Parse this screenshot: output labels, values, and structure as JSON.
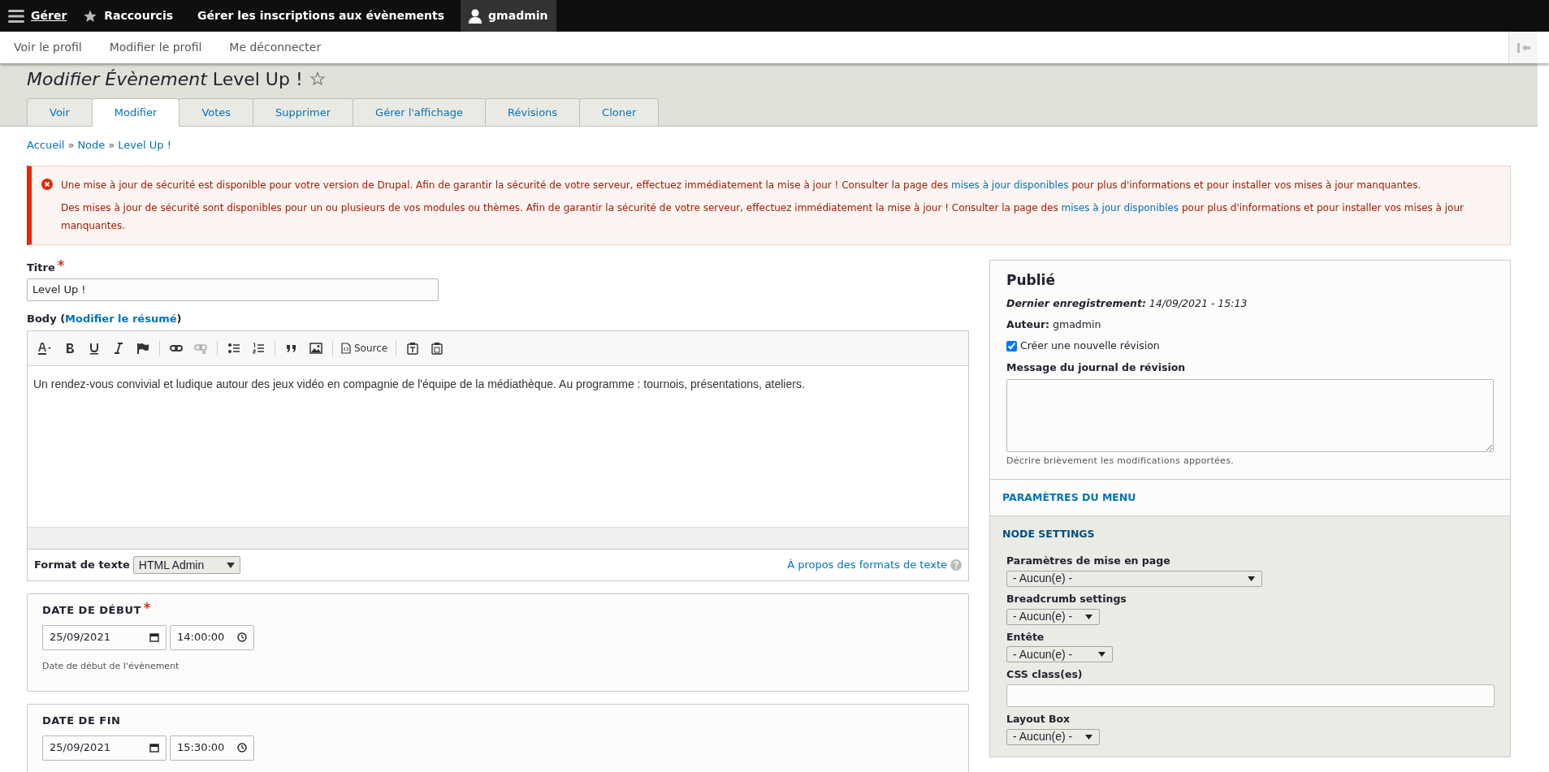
{
  "toolbar": {
    "items": [
      {
        "kind": "menu",
        "label": "Gérer",
        "selected": false
      },
      {
        "kind": "shortcuts",
        "label": "Raccourcis",
        "selected": false
      },
      {
        "kind": "link",
        "label": "Gérer les inscriptions aux évènements",
        "selected": false
      },
      {
        "kind": "user",
        "label": "gmadmin",
        "selected": true
      }
    ]
  },
  "tray": {
    "items": [
      "Voir le profil",
      "Modifier le profil",
      "Me déconnecter"
    ]
  },
  "page_title": {
    "prefix": "Modifier Évènement",
    "name": "Level Up !"
  },
  "tabs": [
    {
      "label": "Voir",
      "selected": false
    },
    {
      "label": "Modifier",
      "selected": true
    },
    {
      "label": "Votes",
      "selected": false
    },
    {
      "label": "Supprimer",
      "selected": false
    },
    {
      "label": "Gérer l'affichage",
      "selected": false
    },
    {
      "label": "Révisions",
      "selected": false
    },
    {
      "label": "Cloner",
      "selected": false
    }
  ],
  "breadcrumb": {
    "separator": "»",
    "items": [
      "Accueil",
      "Node",
      "Level Up !"
    ]
  },
  "alert": {
    "messages": [
      {
        "before": "Une mise à jour de sécurité est disponible pour votre version de Drupal. Afin de garantir la sécurité de votre serveur, effectuez immédiatement la mise à jour ! Consulter la page des",
        "link": "mises à jour disponibles",
        "after": "pour plus d'informations et pour installer vos mises à jour manquantes."
      },
      {
        "before": "Des mises à jour de sécurité sont disponibles pour un ou plusieurs de vos modules ou thèmes. Afin de garantir la sécurité de votre serveur, effectuez immédiatement la mise à jour ! Consulter la page des",
        "link": "mises à jour disponibles",
        "after": "pour plus d'informations et pour installer vos mises à jour manquantes."
      }
    ]
  },
  "title_field": {
    "label": "Titre",
    "required": true,
    "value": "Level Up !"
  },
  "body": {
    "label": "Body",
    "paren_open": "(",
    "paren_close": ")",
    "link": "Modifier le résumé",
    "source_label": "Source",
    "content": "Un rendez-vous convivial et ludique autour des jeux vidéo en compagnie de l'équipe de la médiathèque. Au programme : tournois, présentations, ateliers.",
    "format_label": "Format de texte",
    "format_value": "HTML Admin",
    "help_link": "À propos des formats de texte"
  },
  "dates": [
    {
      "label": "DATE DE DÉBUT",
      "required": true,
      "date": "25/09/2021",
      "time": "14:00:00",
      "description": "Date de début de l'évènement"
    },
    {
      "label": "DATE DE FIN",
      "required": false,
      "date": "25/09/2021",
      "time": "15:30:00"
    }
  ],
  "sidebar": {
    "status": "Publié",
    "last_saved_label": "Dernier enregistrement:",
    "last_saved": "14/09/2021 - 15:13",
    "author_label": "Auteur:",
    "author": "gmadmin",
    "new_revision": {
      "label": "Créer une nouvelle révision",
      "checked": true
    },
    "revision_log": {
      "label": "Message du journal de révision",
      "description": "Décrire brièvement les modifications apportées."
    },
    "sections": [
      {
        "title": "PARAMÈTRES DU MENU",
        "expanded": false
      },
      {
        "title": "NODE SETTINGS",
        "expanded": true,
        "fields": [
          {
            "kind": "select",
            "label": "Paramètres de mise en page",
            "value": "- Aucun(e) -"
          },
          {
            "kind": "select",
            "label": "Breadcrumb settings",
            "value": "- Aucun(e) -"
          },
          {
            "kind": "select",
            "label": "Entête",
            "value": "- Aucun(e) -"
          },
          {
            "kind": "text",
            "label": "CSS class(es)"
          },
          {
            "kind": "select",
            "label": "Layout Box",
            "value": "- Aucun(e) -"
          }
        ]
      }
    ]
  }
}
